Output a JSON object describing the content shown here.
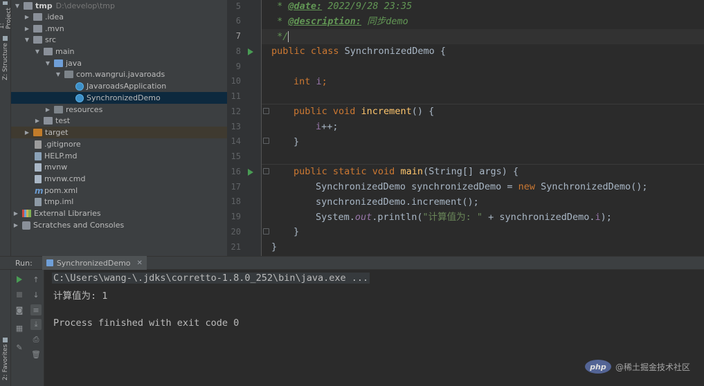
{
  "sidebar_tabs": {
    "project": "1: Project",
    "structure": "Z: Structure",
    "favorites": "2: Favorites"
  },
  "project_tree": [
    {
      "label": "tmp",
      "path": "D:\\develop\\tmp",
      "icon": "folder-icon",
      "expanded": true
    },
    {
      "label": ".idea",
      "icon": "folder-icon",
      "expanded": false
    },
    {
      "label": ".mvn",
      "icon": "folder-icon",
      "expanded": false
    },
    {
      "label": "src",
      "icon": "folder-icon",
      "expanded": true
    },
    {
      "label": "main",
      "icon": "folder-icon",
      "expanded": true
    },
    {
      "label": "java",
      "icon": "source-folder-icon",
      "expanded": true
    },
    {
      "label": "com.wangrui.javaroads",
      "icon": "package-icon",
      "expanded": true
    },
    {
      "label": "JavaroadsApplication",
      "icon": "spring-class-icon"
    },
    {
      "label": "SynchronizedDemo",
      "icon": "class-icon",
      "selected": true
    },
    {
      "label": "resources",
      "icon": "resources-folder-icon",
      "expanded": false
    },
    {
      "label": "test",
      "icon": "test-folder-icon",
      "expanded": false
    },
    {
      "label": "target",
      "icon": "excluded-folder-icon",
      "expanded": false
    },
    {
      "label": ".gitignore",
      "icon": "gitignore-file-icon"
    },
    {
      "label": "HELP.md",
      "icon": "markdown-file-icon"
    },
    {
      "label": "mvnw",
      "icon": "script-file-icon"
    },
    {
      "label": "mvnw.cmd",
      "icon": "cmd-file-icon"
    },
    {
      "label": "pom.xml",
      "icon": "maven-file-icon"
    },
    {
      "label": "tmp.iml",
      "icon": "iml-file-icon"
    },
    {
      "label": "External Libraries",
      "icon": "library-icon",
      "expanded": false
    },
    {
      "label": "Scratches and Consoles",
      "icon": "scratches-icon",
      "expanded": false
    }
  ],
  "editor": {
    "line_numbers": [
      "5",
      "6",
      "7",
      "8",
      "9",
      "10",
      "11",
      "12",
      "13",
      "14",
      "15",
      "16",
      "17",
      "18",
      "19",
      "20",
      "21"
    ],
    "current_line": "7",
    "code": {
      "l5_star": " * ",
      "l5_tag": "@date:",
      "l5_text": " 2022/9/28 23:35",
      "l6_star": " * ",
      "l6_tag": "@description:",
      "l6_text": " 同步demo",
      "l7": " */",
      "l8_kw": "public class ",
      "l8_name": "SynchronizedDemo {",
      "l10_kw": "int ",
      "l10_field": "i",
      "l10_end": ";",
      "l12_kw": "public void ",
      "l12_fn": "increment",
      "l12_end": "() {",
      "l13_field": "i",
      "l13_end": "++;",
      "l14": "}",
      "l16_kw": "public static void ",
      "l16_fn": "main",
      "l16_end": "(String[] args) {",
      "l17_a": "SynchronizedDemo synchronizedDemo = ",
      "l17_kw": "new ",
      "l17_b": "SynchronizedDemo();",
      "l18": "synchronizedDemo.increment();",
      "l19_a": "System.",
      "l19_out": "out",
      "l19_b": ".println(",
      "l19_str": "\"计算值为: \"",
      "l19_c": " + synchronizedDemo.",
      "l19_field": "i",
      "l19_d": ");",
      "l20": "}",
      "l21": "}"
    }
  },
  "run_panel": {
    "label": "Run:",
    "tab_label": "SynchronizedDemo",
    "console_lines": [
      "C:\\Users\\wang-\\.jdks\\corretto-1.8.0_252\\bin\\java.exe ...",
      "计算值为: 1",
      "",
      "Process finished with exit code 0"
    ]
  },
  "watermark": {
    "logo": "php",
    "text": "@稀土掘金技术社区"
  },
  "colors": {
    "keyword": "#cc7832",
    "function": "#ffc66d",
    "string": "#6a8759",
    "field": "#9876aa",
    "doc_comment": "#629755",
    "run_green": "#499c54",
    "selection": "#0d293e"
  }
}
